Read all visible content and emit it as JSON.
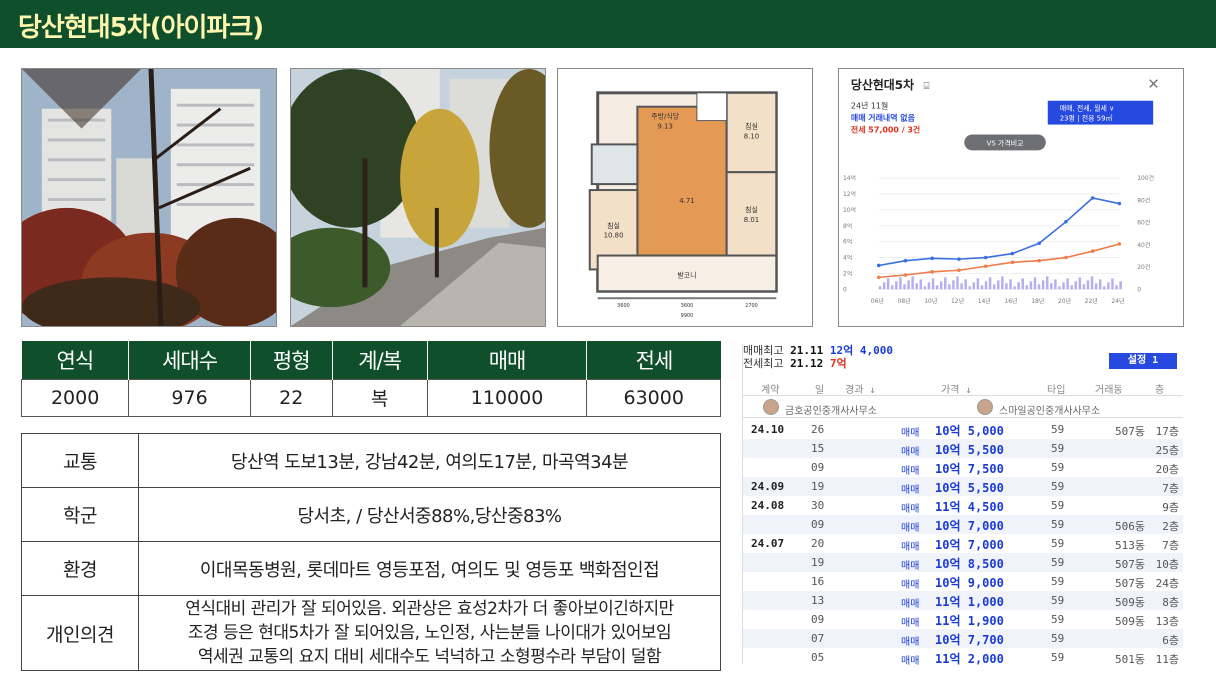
{
  "header": {
    "title": "당산현대5차(아이파크)"
  },
  "specs": {
    "headers": [
      "연식",
      "세대수",
      "평형",
      "계/복",
      "매매",
      "전세"
    ],
    "values": [
      "2000",
      "976",
      "22",
      "복",
      "110000",
      "63000"
    ]
  },
  "info": {
    "rows": [
      {
        "label": "교통",
        "value": "당산역 도보13분, 강남42분, 여의도17분, 마곡역34분"
      },
      {
        "label": "학군",
        "value": "당서초, / 당산서중88%,당산중83%"
      },
      {
        "label": "환경",
        "value": "이대목동병원, 롯데마트 영등포점, 여의도 및 영등포 백화점인접"
      }
    ],
    "opinion": {
      "label": "개인의견",
      "lines": [
        "연식대비 관리가 잘 되어있음. 외관상은 효성2차가 더 좋아보이긴하지만",
        "조경 등은 현대5차가 잘 되어있음, 노인정, 사는분들 나이대가 있어보임",
        "역세권 교통의 요지 대비 세대수도 넉넉하고 소형평수라 부담이 덜함"
      ]
    }
  },
  "floorplan": {
    "rooms": [
      "주방/식당",
      "침실",
      "침실",
      "침실",
      "발코니"
    ],
    "room_sizes": [
      "9.13",
      "8.10",
      "8.01",
      "10.80",
      "4.71"
    ],
    "dims": [
      "3600",
      "3600",
      "2700",
      "9900"
    ]
  },
  "price_chart": {
    "title": "당산현대5차",
    "month": "24년 11월",
    "sale_status": "매매 거래내역 없음",
    "jeonse_status": "전세 57,000 / 3건",
    "filter_line1": "매매, 전세, 월세 ∨",
    "filter_line2": "23평 | 전용 59㎡",
    "compare_button": "VS 가격비교",
    "y_left": [
      "14억",
      "12억",
      "10억",
      "8억",
      "6억",
      "4억",
      "2억",
      "0"
    ],
    "y_right": [
      "100건",
      "80건",
      "60건",
      "40건",
      "20건",
      "0"
    ],
    "x_labels": [
      "06년",
      "08년",
      "10년",
      "12년",
      "14년",
      "16년",
      "18년",
      "20년",
      "22년",
      "24년"
    ],
    "colors": {
      "sale": "#3a6fe0",
      "jeonse": "#f07c4a",
      "volume": "#7a6ee0"
    }
  },
  "chart_data": {
    "type": "line",
    "x": [
      "06년",
      "08년",
      "10년",
      "12년",
      "14년",
      "16년",
      "18년",
      "20년",
      "22년",
      "24년"
    ],
    "series": [
      {
        "values": [
          3.0,
          3.6,
          3.9,
          3.8,
          4.0,
          4.5,
          5.8,
          8.5,
          11.5,
          10.8
        ]
      },
      {
        "values": [
          1.5,
          1.8,
          2.2,
          2.4,
          2.9,
          3.4,
          3.6,
          4.0,
          4.8,
          5.7
        ]
      }
    ],
    "ylim": [
      0,
      14
    ]
  },
  "deals": {
    "high_sale_label": "매매최고",
    "high_sale_date": "21.11",
    "high_sale_price": "12억 4,000",
    "high_jeonse_label": "전세최고",
    "high_jeonse_date": "21.12",
    "high_jeonse_price": "7억",
    "settings_button": "설정 1",
    "columns": [
      "계약",
      "일",
      "경과 ↓",
      "가격 ↓",
      "타입",
      "거래동",
      "층"
    ],
    "agent1": "금호공인중개사사무소",
    "agent2": "스마일공인중개사사무소",
    "rows": [
      {
        "ym": "24.10",
        "d": "26",
        "kind": "매매",
        "price": "10억 5,000",
        "type": "59",
        "bldg": "507동",
        "floor": "17층"
      },
      {
        "ym": "",
        "d": "15",
        "kind": "매매",
        "price": "10억 5,500",
        "type": "59",
        "bldg": "",
        "floor": "25층"
      },
      {
        "ym": "",
        "d": "09",
        "kind": "매매",
        "price": "10억 7,500",
        "type": "59",
        "bldg": "",
        "floor": "20층"
      },
      {
        "ym": "24.09",
        "d": "19",
        "kind": "매매",
        "price": "10억 5,500",
        "type": "59",
        "bldg": "",
        "floor": "7층"
      },
      {
        "ym": "24.08",
        "d": "30",
        "kind": "매매",
        "price": "11억 4,500",
        "type": "59",
        "bldg": "",
        "floor": "9층"
      },
      {
        "ym": "",
        "d": "09",
        "kind": "매매",
        "price": "10억 7,000",
        "type": "59",
        "bldg": "506동",
        "floor": "2층"
      },
      {
        "ym": "24.07",
        "d": "20",
        "kind": "매매",
        "price": "10억 7,000",
        "type": "59",
        "bldg": "513동",
        "floor": "7층"
      },
      {
        "ym": "",
        "d": "19",
        "kind": "매매",
        "price": "10억 8,500",
        "type": "59",
        "bldg": "507동",
        "floor": "10층"
      },
      {
        "ym": "",
        "d": "16",
        "kind": "매매",
        "price": "10억 9,000",
        "type": "59",
        "bldg": "507동",
        "floor": "24층"
      },
      {
        "ym": "",
        "d": "13",
        "kind": "매매",
        "price": "11억 1,000",
        "type": "59",
        "bldg": "509동",
        "floor": "8층"
      },
      {
        "ym": "",
        "d": "09",
        "kind": "매매",
        "price": "11억 1,900",
        "type": "59",
        "bldg": "509동",
        "floor": "13층"
      },
      {
        "ym": "",
        "d": "07",
        "kind": "매매",
        "price": "10억 7,700",
        "type": "59",
        "bldg": "",
        "floor": "6층"
      },
      {
        "ym": "",
        "d": "05",
        "kind": "매매",
        "price": "11억 2,000",
        "type": "59",
        "bldg": "501동",
        "floor": "11층"
      }
    ]
  }
}
